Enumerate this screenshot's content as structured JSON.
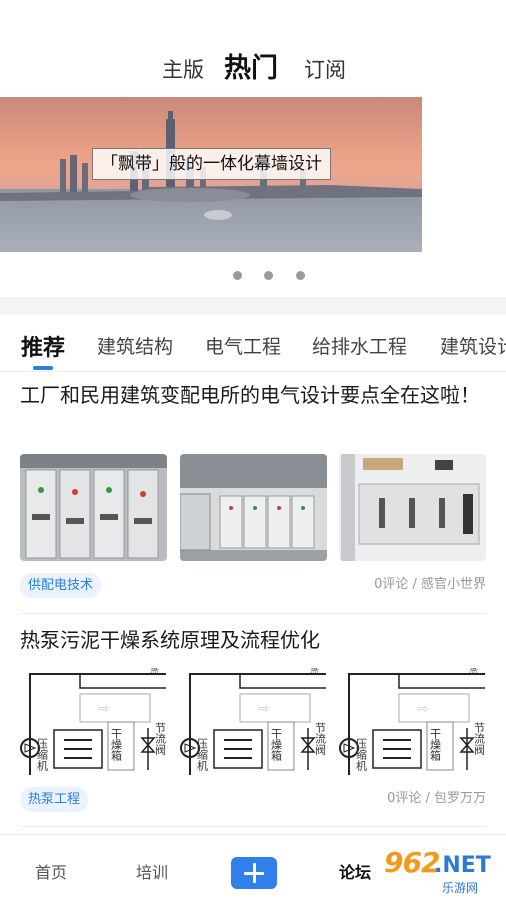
{
  "top_tabs": {
    "main": "主版",
    "hot": "热门",
    "subscribe": "订阅"
  },
  "banner": {
    "caption": "「飘带」般的一体化幕墙设计",
    "page_count": 3
  },
  "categories": [
    "推荐",
    "建筑结构",
    "电气工程",
    "给排水工程",
    "建筑设计"
  ],
  "articles": [
    {
      "title": "工厂和民用建筑变配电所的电气设计要点全在这啦！",
      "tag": "供配电技术",
      "meta": "0评论 / 感官小世界",
      "image_icons": [
        "switchgear-photo",
        "switchgear-room-photo",
        "electrical-cabinet-photo"
      ]
    },
    {
      "title": "热泵污泥干燥系统原理及流程优化",
      "tag": "热泵工程",
      "meta": "0评论 / 包罗万万",
      "diagram_labels": {
        "compressor": "压缩机",
        "dryer": "干燥箱",
        "valve": "节流阀",
        "corner": "蒸"
      }
    }
  ],
  "bottom_nav": {
    "home": "首页",
    "training": "培训",
    "forum": "论坛"
  },
  "watermark": {
    "num": "962",
    "net": ".NET",
    "sub": "乐游网"
  },
  "colors": {
    "accent": "#2a7de1",
    "tag_bg": "#eaf3fd",
    "watermark_orange": "#f39a1d",
    "watermark_blue": "#2b7bd4"
  }
}
